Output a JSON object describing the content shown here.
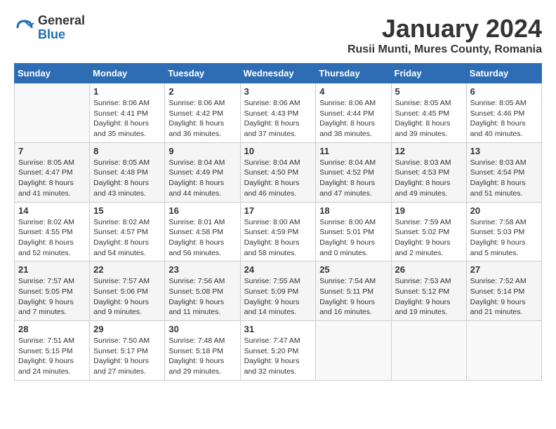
{
  "logo": {
    "general": "General",
    "blue": "Blue"
  },
  "title": "January 2024",
  "location": "Rusii Munti, Mures County, Romania",
  "days_of_week": [
    "Sunday",
    "Monday",
    "Tuesday",
    "Wednesday",
    "Thursday",
    "Friday",
    "Saturday"
  ],
  "weeks": [
    [
      {
        "day": "",
        "info": ""
      },
      {
        "day": "1",
        "info": "Sunrise: 8:06 AM\nSunset: 4:41 PM\nDaylight: 8 hours\nand 35 minutes."
      },
      {
        "day": "2",
        "info": "Sunrise: 8:06 AM\nSunset: 4:42 PM\nDaylight: 8 hours\nand 36 minutes."
      },
      {
        "day": "3",
        "info": "Sunrise: 8:06 AM\nSunset: 4:43 PM\nDaylight: 8 hours\nand 37 minutes."
      },
      {
        "day": "4",
        "info": "Sunrise: 8:06 AM\nSunset: 4:44 PM\nDaylight: 8 hours\nand 38 minutes."
      },
      {
        "day": "5",
        "info": "Sunrise: 8:05 AM\nSunset: 4:45 PM\nDaylight: 8 hours\nand 39 minutes."
      },
      {
        "day": "6",
        "info": "Sunrise: 8:05 AM\nSunset: 4:46 PM\nDaylight: 8 hours\nand 40 minutes."
      }
    ],
    [
      {
        "day": "7",
        "info": "Sunrise: 8:05 AM\nSunset: 4:47 PM\nDaylight: 8 hours\nand 41 minutes."
      },
      {
        "day": "8",
        "info": "Sunrise: 8:05 AM\nSunset: 4:48 PM\nDaylight: 8 hours\nand 43 minutes."
      },
      {
        "day": "9",
        "info": "Sunrise: 8:04 AM\nSunset: 4:49 PM\nDaylight: 8 hours\nand 44 minutes."
      },
      {
        "day": "10",
        "info": "Sunrise: 8:04 AM\nSunset: 4:50 PM\nDaylight: 8 hours\nand 46 minutes."
      },
      {
        "day": "11",
        "info": "Sunrise: 8:04 AM\nSunset: 4:52 PM\nDaylight: 8 hours\nand 47 minutes."
      },
      {
        "day": "12",
        "info": "Sunrise: 8:03 AM\nSunset: 4:53 PM\nDaylight: 8 hours\nand 49 minutes."
      },
      {
        "day": "13",
        "info": "Sunrise: 8:03 AM\nSunset: 4:54 PM\nDaylight: 8 hours\nand 51 minutes."
      }
    ],
    [
      {
        "day": "14",
        "info": "Sunrise: 8:02 AM\nSunset: 4:55 PM\nDaylight: 8 hours\nand 52 minutes."
      },
      {
        "day": "15",
        "info": "Sunrise: 8:02 AM\nSunset: 4:57 PM\nDaylight: 8 hours\nand 54 minutes."
      },
      {
        "day": "16",
        "info": "Sunrise: 8:01 AM\nSunset: 4:58 PM\nDaylight: 8 hours\nand 56 minutes."
      },
      {
        "day": "17",
        "info": "Sunrise: 8:00 AM\nSunset: 4:59 PM\nDaylight: 8 hours\nand 58 minutes."
      },
      {
        "day": "18",
        "info": "Sunrise: 8:00 AM\nSunset: 5:01 PM\nDaylight: 9 hours\nand 0 minutes."
      },
      {
        "day": "19",
        "info": "Sunrise: 7:59 AM\nSunset: 5:02 PM\nDaylight: 9 hours\nand 2 minutes."
      },
      {
        "day": "20",
        "info": "Sunrise: 7:58 AM\nSunset: 5:03 PM\nDaylight: 9 hours\nand 5 minutes."
      }
    ],
    [
      {
        "day": "21",
        "info": "Sunrise: 7:57 AM\nSunset: 5:05 PM\nDaylight: 9 hours\nand 7 minutes."
      },
      {
        "day": "22",
        "info": "Sunrise: 7:57 AM\nSunset: 5:06 PM\nDaylight: 9 hours\nand 9 minutes."
      },
      {
        "day": "23",
        "info": "Sunrise: 7:56 AM\nSunset: 5:08 PM\nDaylight: 9 hours\nand 11 minutes."
      },
      {
        "day": "24",
        "info": "Sunrise: 7:55 AM\nSunset: 5:09 PM\nDaylight: 9 hours\nand 14 minutes."
      },
      {
        "day": "25",
        "info": "Sunrise: 7:54 AM\nSunset: 5:11 PM\nDaylight: 9 hours\nand 16 minutes."
      },
      {
        "day": "26",
        "info": "Sunrise: 7:53 AM\nSunset: 5:12 PM\nDaylight: 9 hours\nand 19 minutes."
      },
      {
        "day": "27",
        "info": "Sunrise: 7:52 AM\nSunset: 5:14 PM\nDaylight: 9 hours\nand 21 minutes."
      }
    ],
    [
      {
        "day": "28",
        "info": "Sunrise: 7:51 AM\nSunset: 5:15 PM\nDaylight: 9 hours\nand 24 minutes."
      },
      {
        "day": "29",
        "info": "Sunrise: 7:50 AM\nSunset: 5:17 PM\nDaylight: 9 hours\nand 27 minutes."
      },
      {
        "day": "30",
        "info": "Sunrise: 7:48 AM\nSunset: 5:18 PM\nDaylight: 9 hours\nand 29 minutes."
      },
      {
        "day": "31",
        "info": "Sunrise: 7:47 AM\nSunset: 5:20 PM\nDaylight: 9 hours\nand 32 minutes."
      },
      {
        "day": "",
        "info": ""
      },
      {
        "day": "",
        "info": ""
      },
      {
        "day": "",
        "info": ""
      }
    ]
  ]
}
